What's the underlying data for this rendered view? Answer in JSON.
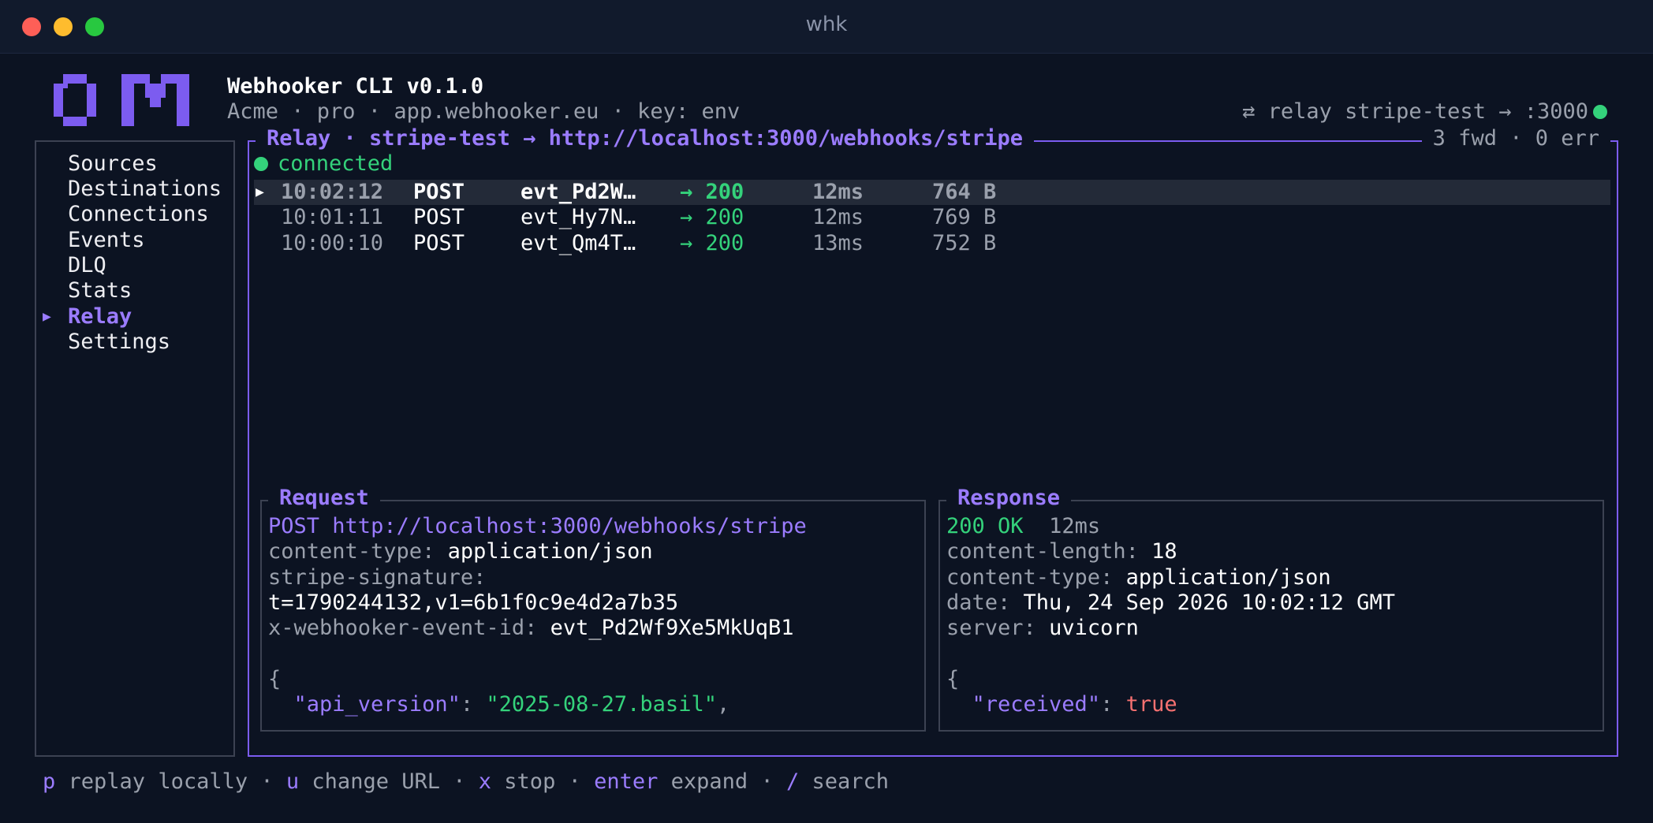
{
  "window": {
    "title": "whk"
  },
  "header": {
    "title": "Webhooker CLI v0.1.0",
    "subtitle": "Acme · pro · app.webhooker.eu · key: env",
    "relay_status": "⇄ relay stripe-test → :3000"
  },
  "sidebar": {
    "items": [
      {
        "label": "Sources"
      },
      {
        "label": "Destinations"
      },
      {
        "label": "Connections"
      },
      {
        "label": "Events"
      },
      {
        "label": "DLQ"
      },
      {
        "label": "Stats"
      },
      {
        "label": "Relay",
        "active": true
      },
      {
        "label": "Settings"
      }
    ]
  },
  "relay": {
    "title": "Relay · stripe-test → http://localhost:3000/webhooks/stripe",
    "counts": "3 fwd · 0 err",
    "connection": "connected",
    "rows": [
      {
        "time": "10:02:12",
        "method": "POST",
        "event": "evt_Pd2W…",
        "status": "→ 200",
        "latency": "12ms",
        "size": "764 B",
        "selected": true
      },
      {
        "time": "10:01:11",
        "method": "POST",
        "event": "evt_Hy7N…",
        "status": "→ 200",
        "latency": "12ms",
        "size": "769 B"
      },
      {
        "time": "10:00:10",
        "method": "POST",
        "event": "evt_Qm4T…",
        "status": "→ 200",
        "latency": "13ms",
        "size": "752 B"
      }
    ]
  },
  "request": {
    "title": "Request",
    "method": "POST",
    "url": "http://localhost:3000/webhooks/stripe",
    "headers": [
      {
        "key": "content-type:",
        "value": "application/json"
      },
      {
        "key": "stripe-signature:",
        "value": ""
      },
      {
        "key": "",
        "value": "t=1790244132,v1=6b1f0c9e4d2a7b35"
      },
      {
        "key": "x-webhooker-event-id:",
        "value": "evt_Pd2Wf9Xe5MkUqB1"
      }
    ],
    "body_open": "{",
    "body_key": "\"api_version\"",
    "body_value": "\"2025-08-27.basil\"",
    "body_tail": ","
  },
  "response": {
    "title": "Response",
    "status": "200 OK",
    "latency": "12ms",
    "headers": [
      {
        "key": "content-length:",
        "value": "18"
      },
      {
        "key": "content-type:",
        "value": "application/json"
      },
      {
        "key": "date:",
        "value": "Thu, 24 Sep 2026 10:02:12 GMT"
      },
      {
        "key": "server:",
        "value": "uvicorn"
      }
    ],
    "body_open": "{",
    "body_key": "\"received\"",
    "body_value": "true"
  },
  "footer": {
    "keys": [
      {
        "key": "p",
        "label": "replay locally"
      },
      {
        "key": "u",
        "label": "change URL"
      },
      {
        "key": "x",
        "label": "stop"
      },
      {
        "key": "enter",
        "label": "expand"
      },
      {
        "key": "/",
        "label": "search"
      }
    ],
    "separator": " · "
  },
  "colors": {
    "accent": "#7c5cf0",
    "success": "#34d27b",
    "error": "#f87171",
    "background": "#0c1322"
  }
}
